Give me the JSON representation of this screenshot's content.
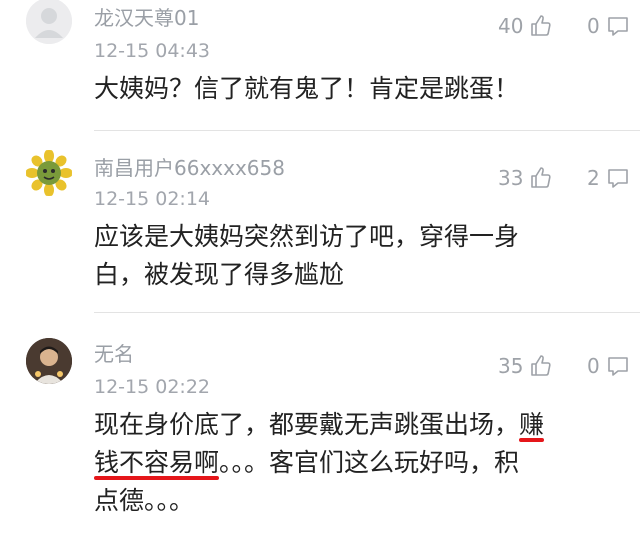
{
  "comments": [
    {
      "username": "龙汉天尊01",
      "time": "12-15 04:43",
      "likes": "40",
      "replies": "0",
      "text": "大姨妈？信了就有鬼了！肯定是跳蛋！",
      "avatar": "default-avatar"
    },
    {
      "username": "南昌用户66xxxx658",
      "time": "12-15 02:14",
      "likes": "33",
      "replies": "2",
      "line1": "应该是大姨妈突然到访了吧，穿得一身",
      "line2": "白，被发现了得多尴尬",
      "avatar": "sunflower-avatar"
    },
    {
      "username": "无名",
      "time": "12-15 02:22",
      "likes": "35",
      "replies": "0",
      "line1_a": "现在身价底了，都要戴无声跳蛋出场，",
      "line1_b": "赚",
      "line2_a": "钱不容易啊",
      "line2_b": "。。。客官们这么玩好吗，积",
      "line3": "点德。。。",
      "avatar": "photo-avatar"
    }
  ],
  "colors": {
    "underline": "#e5161a",
    "meta": "#9ea2a8",
    "text": "#222222"
  }
}
